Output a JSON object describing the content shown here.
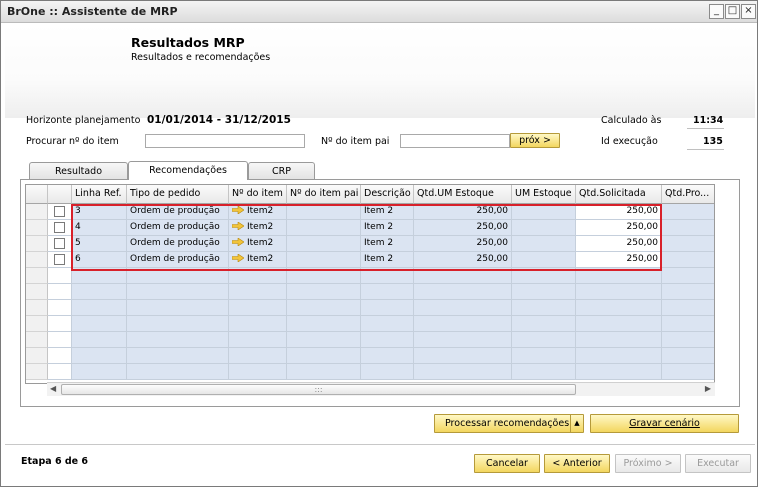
{
  "window": {
    "title": "BrOne :: Assistente de MRP",
    "min": "_",
    "max": "□",
    "close": "×"
  },
  "header": {
    "title": "Resultados MRP",
    "subtitle": "Resultados e recomendações"
  },
  "info": {
    "horizonte_label": "Horizonte planejamento",
    "horizonte_value": "01/01/2014 - 31/12/2015",
    "calculado_label": "Calculado às",
    "calculado_value": "11:34",
    "procurar_label": "Procurar nº do item",
    "procurar_value": "",
    "item_pai_label": "Nº do item pai",
    "item_pai_value": "",
    "prox_button": "próx >",
    "id_exec_label": "Id execução",
    "id_exec_value": "135"
  },
  "tabs": [
    "Resultado",
    "Recomendações",
    "CRP"
  ],
  "active_tab": "Recomendações",
  "grid": {
    "columns": [
      "",
      "Linha Ref.",
      "Tipo de pedido",
      "Nº do item",
      "Nº do item pai",
      "Descrição",
      "Qtd.UM Estoque",
      "UM Estoque",
      "Qtd.Solicitada",
      "Qtd.Pro..."
    ],
    "rows": [
      {
        "linha": "3",
        "tipo": "Ordem de produção",
        "item": "Item2",
        "item_pai": "",
        "descricao": "Item 2",
        "qtd_um": "250,00",
        "um": "",
        "qtd_sol": "250,00",
        "qtd_pro": ""
      },
      {
        "linha": "4",
        "tipo": "Ordem de produção",
        "item": "Item2",
        "item_pai": "",
        "descricao": "Item 2",
        "qtd_um": "250,00",
        "um": "",
        "qtd_sol": "250,00",
        "qtd_pro": ""
      },
      {
        "linha": "5",
        "tipo": "Ordem de produção",
        "item": "Item2",
        "item_pai": "",
        "descricao": "Item 2",
        "qtd_um": "250,00",
        "um": "",
        "qtd_sol": "250,00",
        "qtd_pro": ""
      },
      {
        "linha": "6",
        "tipo": "Ordem de produção",
        "item": "Item2",
        "item_pai": "",
        "descricao": "Item 2",
        "qtd_um": "250,00",
        "um": "",
        "qtd_sol": "250,00",
        "qtd_pro": ""
      }
    ],
    "scroll_grip": ":::"
  },
  "actions": {
    "processar": "Processar recomendações",
    "gravar": "Gravar cenário",
    "dropdown_glyph": "▲"
  },
  "footer": {
    "step": "Etapa 6 de 6",
    "cancelar": "Cancelar",
    "anterior": "< Anterior",
    "proximo": "Próximo >",
    "executar": "Executar"
  },
  "colors": {
    "accent": "#f3d65f",
    "highlight": "#d8202a",
    "row_blue": "#dbe4f2"
  }
}
